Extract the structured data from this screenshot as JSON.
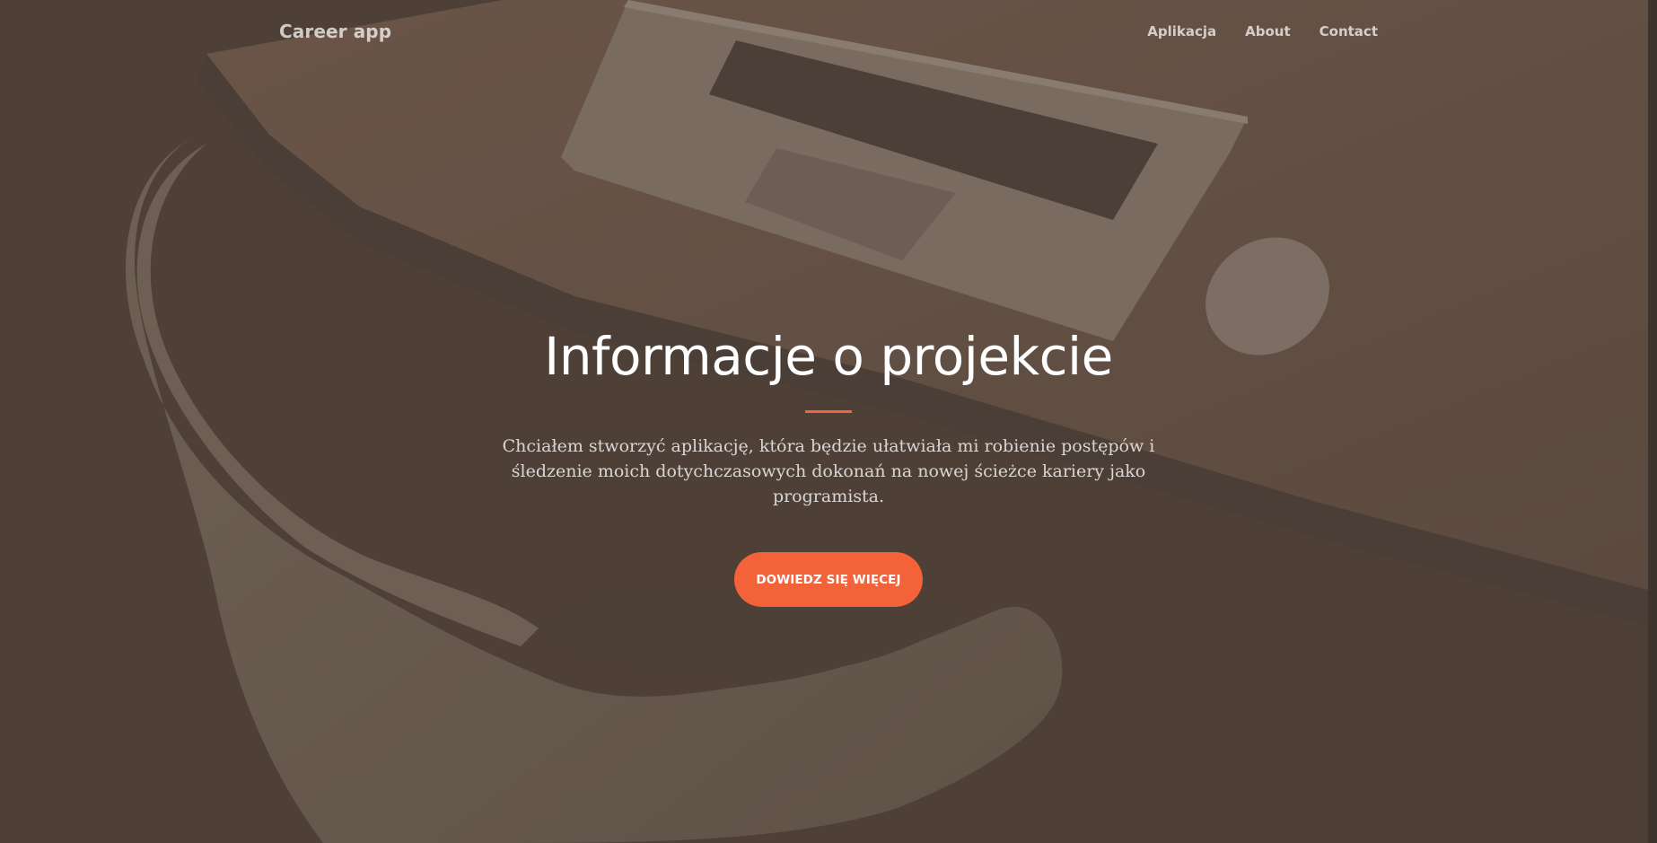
{
  "navbar": {
    "brand": "Career app",
    "links": [
      {
        "label": "Aplikacja"
      },
      {
        "label": "About"
      },
      {
        "label": "Contact"
      }
    ]
  },
  "hero": {
    "title": "Informacje o projekcie",
    "text": "Chciałem stworzyć aplikację, która będzie ułatwiała mi robienie postępów i śledzenie moich dotychczasowych dokonań na nowej ścieżce kariery jako programista.",
    "cta_label": "Dowiedz się więcej"
  },
  "colors": {
    "accent": "#f4623a",
    "overlay": "#4e4037"
  }
}
